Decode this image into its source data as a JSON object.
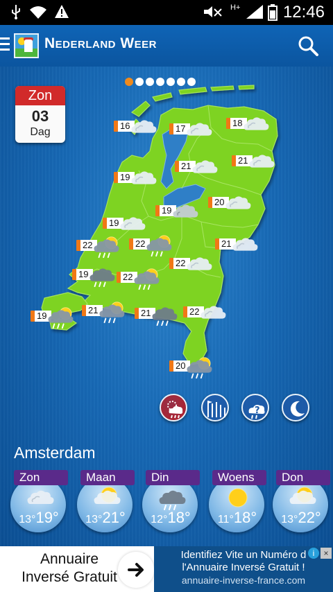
{
  "status_bar": {
    "time": "12:46",
    "icons": [
      "usb-icon",
      "wifi-icon",
      "warning-icon",
      "mute-icon",
      "signal-icon",
      "battery-icon"
    ],
    "network": "H+"
  },
  "app_bar": {
    "title": "Nederland Weer",
    "icons": [
      "menu-icon",
      "app-logo-icon",
      "search-icon"
    ]
  },
  "pager": {
    "count": 7,
    "active": 0
  },
  "day": {
    "weekday": "Zon",
    "date": "03",
    "label": "Dag"
  },
  "map": {
    "land_color": "#7ed321",
    "markers": [
      {
        "id": "m1",
        "temp": "16",
        "icon": "cloud"
      },
      {
        "id": "m2",
        "temp": "17",
        "icon": "cloud"
      },
      {
        "id": "m3",
        "temp": "18",
        "icon": "cloud"
      },
      {
        "id": "m4",
        "temp": "21",
        "icon": "cloud"
      },
      {
        "id": "m5",
        "temp": "21",
        "icon": "cloud"
      },
      {
        "id": "m6",
        "temp": "19",
        "icon": "cloud"
      },
      {
        "id": "m7",
        "temp": "19",
        "icon": "cloud-dark"
      },
      {
        "id": "m8",
        "temp": "20",
        "icon": "cloud"
      },
      {
        "id": "m9",
        "temp": "19",
        "icon": "cloud"
      },
      {
        "id": "m10",
        "temp": "22",
        "icon": "sun-rain"
      },
      {
        "id": "m11",
        "temp": "22",
        "icon": "sun-rain"
      },
      {
        "id": "m12",
        "temp": "21",
        "icon": "cloud"
      },
      {
        "id": "m13",
        "temp": "22",
        "icon": "cloud"
      },
      {
        "id": "m14",
        "temp": "19",
        "icon": "rain"
      },
      {
        "id": "m15",
        "temp": "22",
        "icon": "sun-rain"
      },
      {
        "id": "m16",
        "temp": "19",
        "icon": "sun-rain"
      },
      {
        "id": "m17",
        "temp": "21",
        "icon": "sun-rain"
      },
      {
        "id": "m18",
        "temp": "21",
        "icon": "rain"
      },
      {
        "id": "m19",
        "temp": "22",
        "icon": "cloud"
      },
      {
        "id": "m20",
        "temp": "20",
        "icon": "sun-rain"
      }
    ]
  },
  "view_modes": [
    {
      "name": "rain-map",
      "icon": "rain-cloud-icon",
      "color": "#b3202b"
    },
    {
      "name": "wind",
      "icon": "wind-icon",
      "color": "#1e5aa8"
    },
    {
      "name": "weather-alert",
      "icon": "question-cloud-icon",
      "color": "#1e5aa8"
    },
    {
      "name": "night",
      "icon": "moon-icon",
      "color": "#1e5aa8"
    }
  ],
  "city": "Amsterdam",
  "forecast": [
    {
      "day": "Zon",
      "min": "13°",
      "max": "19°",
      "icon": "cloud"
    },
    {
      "day": "Maan",
      "min": "13°",
      "max": "21°",
      "icon": "sun-cloud"
    },
    {
      "day": "Din",
      "min": "12°",
      "max": "18°",
      "icon": "rain"
    },
    {
      "day": "Woens",
      "min": "11°",
      "max": "18°",
      "icon": "sun"
    },
    {
      "day": "Don",
      "min": "13°",
      "max": "22°",
      "icon": "sun-cloud"
    }
  ],
  "ad": {
    "left_line1": "Annuaire",
    "left_line2": "Inversé Gratuit",
    "right_line1": "Identifiez Vite un Numéro d",
    "right_line2": "l'Annuaire Inversé Gratuit !",
    "right_url": "annuaire-inverse-france.com",
    "info": "i",
    "close": "×"
  }
}
